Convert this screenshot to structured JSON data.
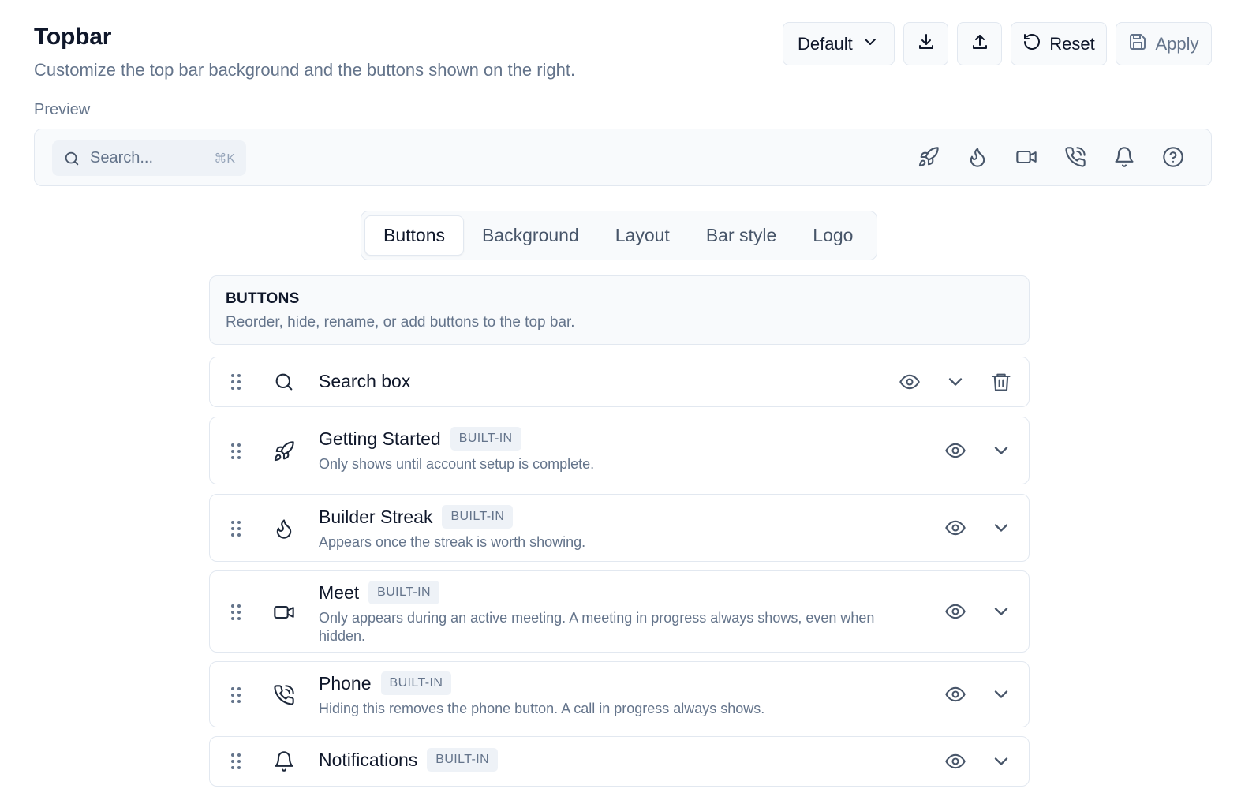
{
  "header": {
    "title": "Topbar",
    "subtitle": "Customize the top bar background and the buttons shown on the right."
  },
  "toolbar": {
    "preset_label": "Default",
    "reset_label": "Reset",
    "apply_label": "Apply"
  },
  "preview": {
    "label": "Preview",
    "search_placeholder": "Search...",
    "search_shortcut": "⌘K",
    "icons": [
      "rocket-icon",
      "flame-icon",
      "video-icon",
      "phone-icon",
      "bell-icon",
      "help-circle-icon"
    ]
  },
  "tabs": [
    {
      "label": "Buttons",
      "active": true
    },
    {
      "label": "Background",
      "active": false
    },
    {
      "label": "Layout",
      "active": false
    },
    {
      "label": "Bar style",
      "active": false
    },
    {
      "label": "Logo",
      "active": false
    }
  ],
  "section": {
    "title": "BUTTONS",
    "description": "Reorder, hide, rename, or add buttons to the top bar."
  },
  "buttons": [
    {
      "name": "Search box",
      "icon": "search-icon",
      "badge": "",
      "description": "",
      "deletable": true
    },
    {
      "name": "Getting Started",
      "icon": "rocket-icon",
      "badge": "BUILT-IN",
      "description": "Only shows until account setup is complete.",
      "deletable": false
    },
    {
      "name": "Builder Streak",
      "icon": "flame-icon",
      "badge": "BUILT-IN",
      "description": "Appears once the streak is worth showing.",
      "deletable": false
    },
    {
      "name": "Meet",
      "icon": "video-icon",
      "badge": "BUILT-IN",
      "description": "Only appears during an active meeting. A meeting in progress always shows, even when hidden.",
      "deletable": false
    },
    {
      "name": "Phone",
      "icon": "phone-icon",
      "badge": "BUILT-IN",
      "description": "Hiding this removes the phone button. A call in progress always shows.",
      "deletable": false
    },
    {
      "name": "Notifications",
      "icon": "bell-icon",
      "badge": "BUILT-IN",
      "description": "",
      "deletable": false
    }
  ]
}
